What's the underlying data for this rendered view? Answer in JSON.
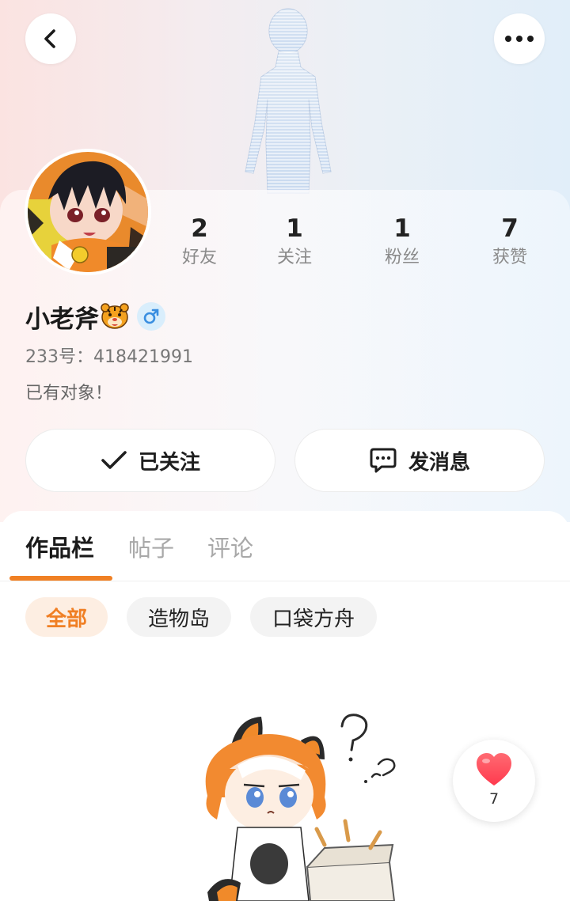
{
  "header": {
    "back_icon": "chevron-left-icon",
    "more_icon": "more-horizontal-icon"
  },
  "profile": {
    "name": "小老斧",
    "name_emoji": "tiger-face-icon",
    "gender_icon": "male-icon",
    "uid": "233号：418421991",
    "bio": "已有对象！",
    "stats": [
      {
        "value": "2",
        "label": "好友"
      },
      {
        "value": "1",
        "label": "关注"
      },
      {
        "value": "1",
        "label": "粉丝"
      },
      {
        "value": "7",
        "label": "获赞"
      }
    ]
  },
  "actions": {
    "follow_label": "已关注",
    "message_label": "发消息"
  },
  "tabs": [
    {
      "label": "作品栏",
      "active": true
    },
    {
      "label": "帖子",
      "active": false
    },
    {
      "label": "评论",
      "active": false
    }
  ],
  "filters": [
    {
      "label": "全部",
      "active": true
    },
    {
      "label": "造物岛",
      "active": false
    },
    {
      "label": "口袋方舟",
      "active": false
    }
  ],
  "like_button": {
    "count": "7"
  },
  "colors": {
    "accent": "#f08024",
    "accent_bg": "#fdeee2",
    "gender_bg": "#d9eefc",
    "heart": "#ff4d5e"
  }
}
